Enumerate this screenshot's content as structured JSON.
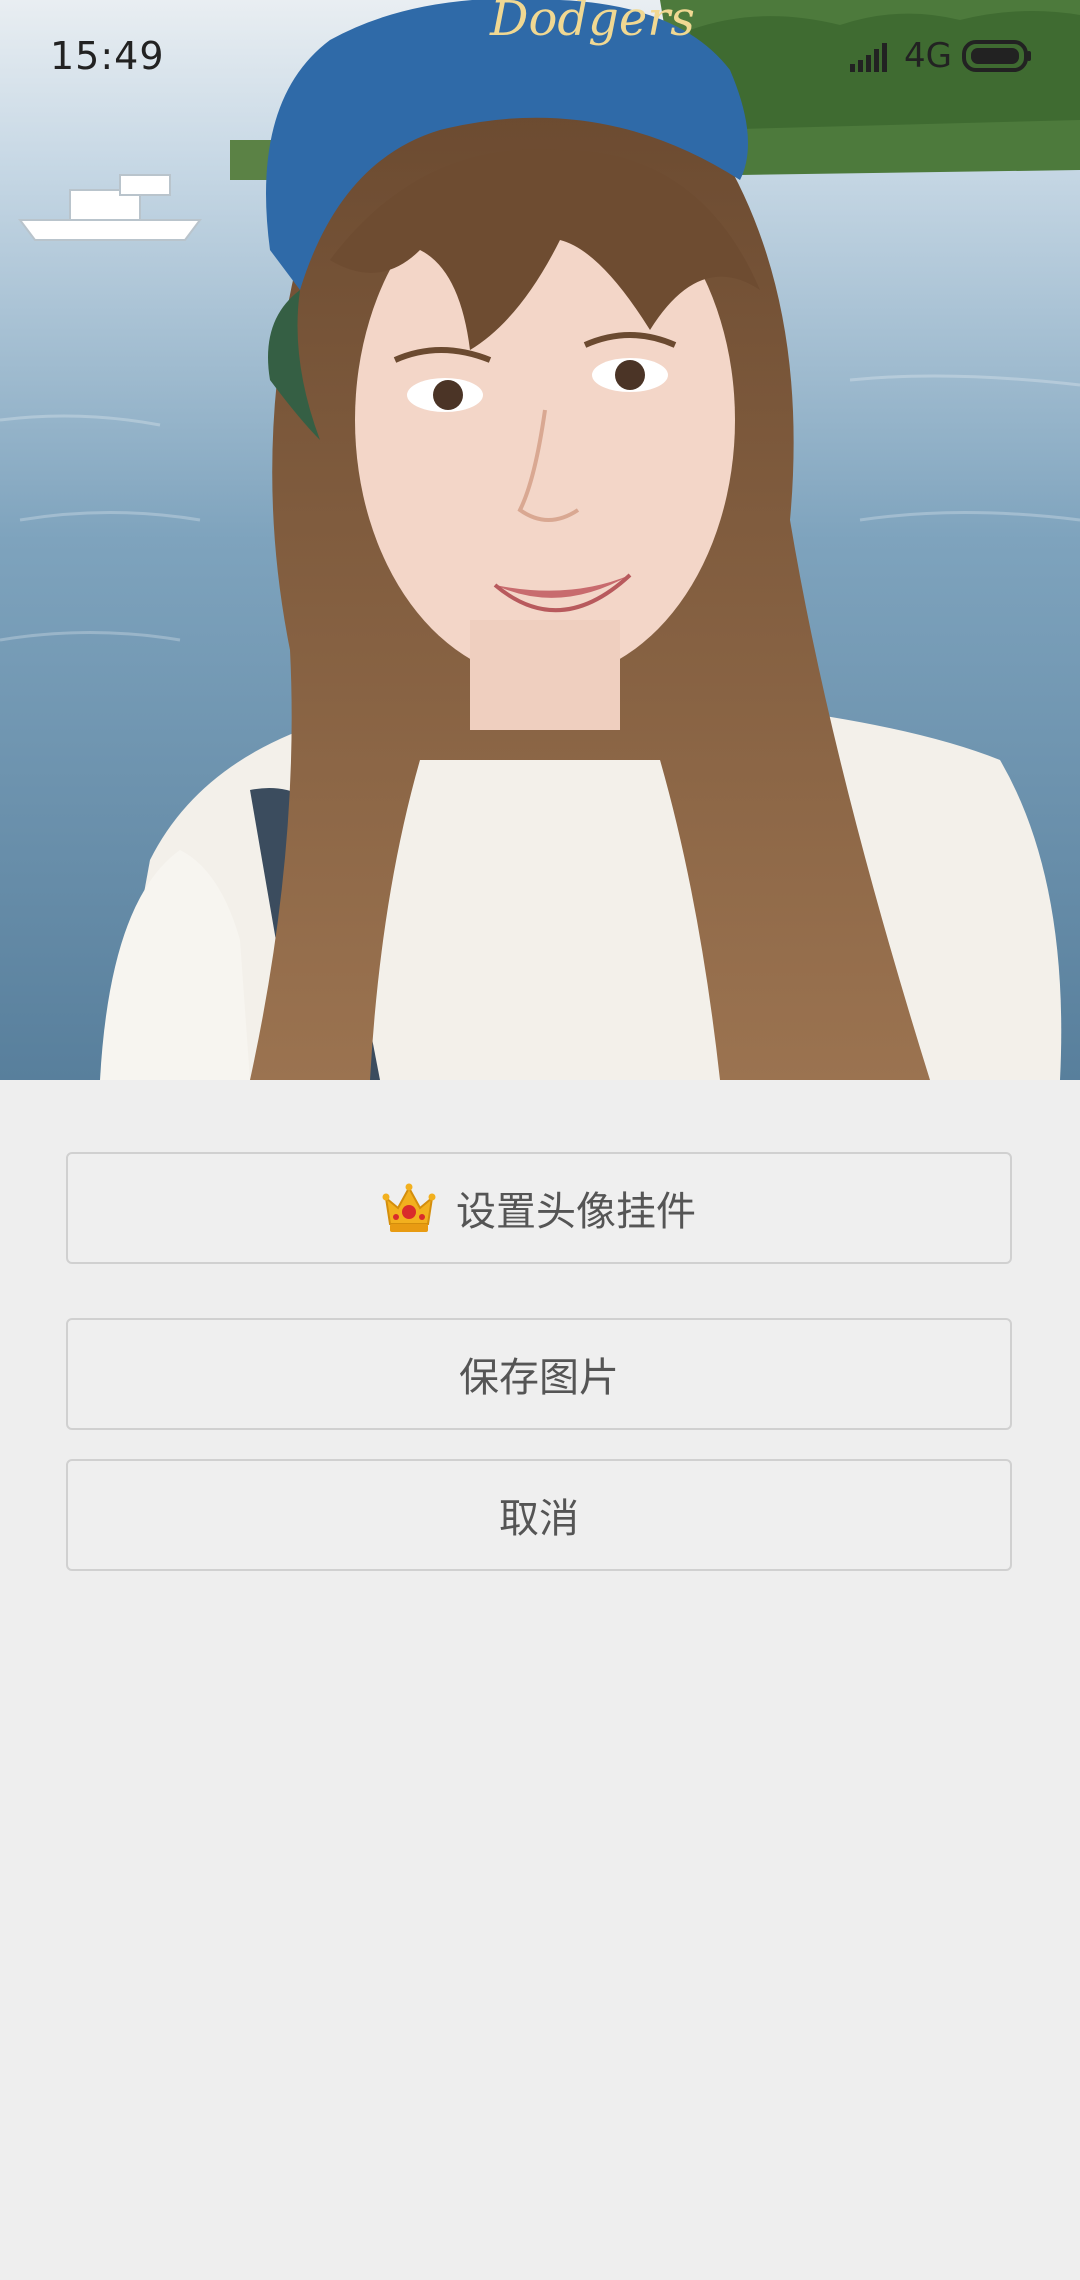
{
  "status_bar": {
    "time": "15:49",
    "network": "4G",
    "icons": [
      "signal-icon",
      "battery-icon"
    ]
  },
  "photo": {
    "subject": "profile-photo",
    "cap_text": "Dodgers"
  },
  "actions": {
    "set_pendant_label": "设置头像挂件",
    "set_pendant_icon": "crown-icon",
    "save_label": "保存图片",
    "cancel_label": "取消"
  },
  "colors": {
    "background": "#eeeeee",
    "button_border": "#d0d0d0",
    "button_text": "#555555",
    "crown": "#f2b01e"
  }
}
